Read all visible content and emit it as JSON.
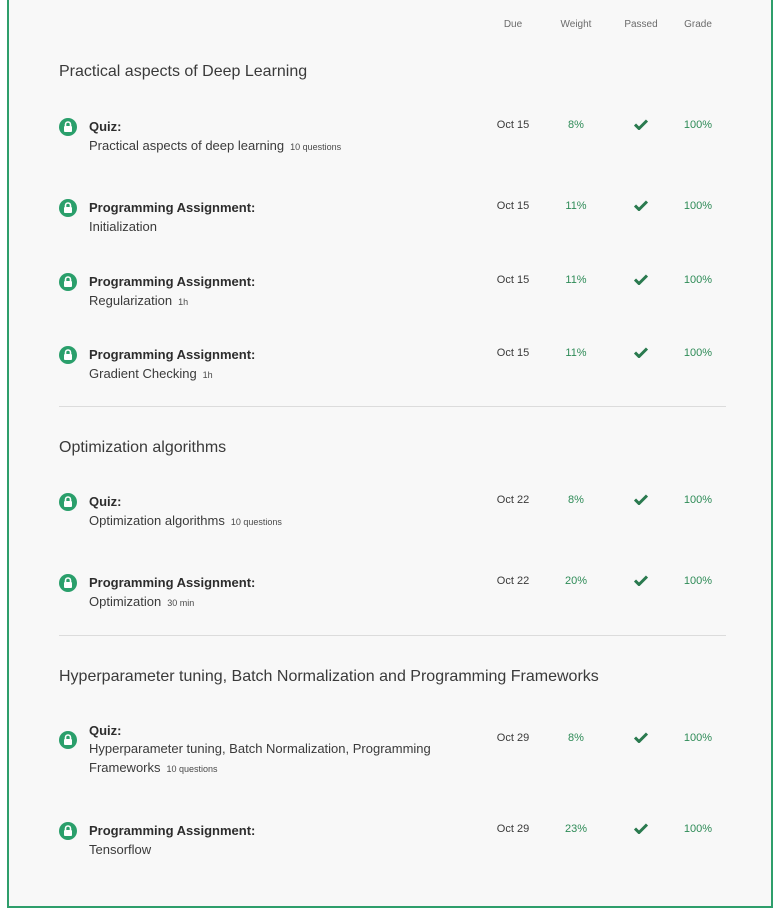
{
  "columns": {
    "due": "Due",
    "weight": "Weight",
    "passed": "Passed",
    "grade": "Grade"
  },
  "sections": [
    {
      "title": "Practical aspects of Deep Learning",
      "items": [
        {
          "type": "Quiz:",
          "name": "Practical aspects of deep learning",
          "meta": "10 questions",
          "due": "Oct 15",
          "weight": "8%",
          "grade": "100%"
        },
        {
          "type": "Programming Assignment:",
          "name": "Initialization",
          "meta": "",
          "due": "Oct 15",
          "weight": "11%",
          "grade": "100%"
        },
        {
          "type": "Programming Assignment:",
          "name": "Regularization",
          "meta": "1h",
          "due": "Oct 15",
          "weight": "11%",
          "grade": "100%"
        },
        {
          "type": "Programming Assignment:",
          "name": "Gradient Checking",
          "meta": "1h",
          "due": "Oct 15",
          "weight": "11%",
          "grade": "100%"
        }
      ]
    },
    {
      "title": "Optimization algorithms",
      "items": [
        {
          "type": "Quiz:",
          "name": "Optimization algorithms",
          "meta": "10 questions",
          "due": "Oct 22",
          "weight": "8%",
          "grade": "100%"
        },
        {
          "type": "Programming Assignment:",
          "name": "Optimization",
          "meta": "30 min",
          "due": "Oct 22",
          "weight": "20%",
          "grade": "100%"
        }
      ]
    },
    {
      "title": "Hyperparameter tuning, Batch Normalization and Programming Frameworks",
      "items": [
        {
          "type": "Quiz:",
          "name": "Hyperparameter tuning, Batch Normalization, Programming Frameworks",
          "meta": "10 questions",
          "due": "Oct 29",
          "weight": "8%",
          "grade": "100%"
        },
        {
          "type": "Programming Assignment:",
          "name": "Tensorflow",
          "meta": "",
          "due": "Oct 29",
          "weight": "23%",
          "grade": "100%"
        }
      ]
    }
  ],
  "icons": {
    "lock": "lock-icon",
    "passed": "checkmark-icon"
  },
  "colors": {
    "accent": "#2a9f6b",
    "border": "#2e9e6b"
  }
}
